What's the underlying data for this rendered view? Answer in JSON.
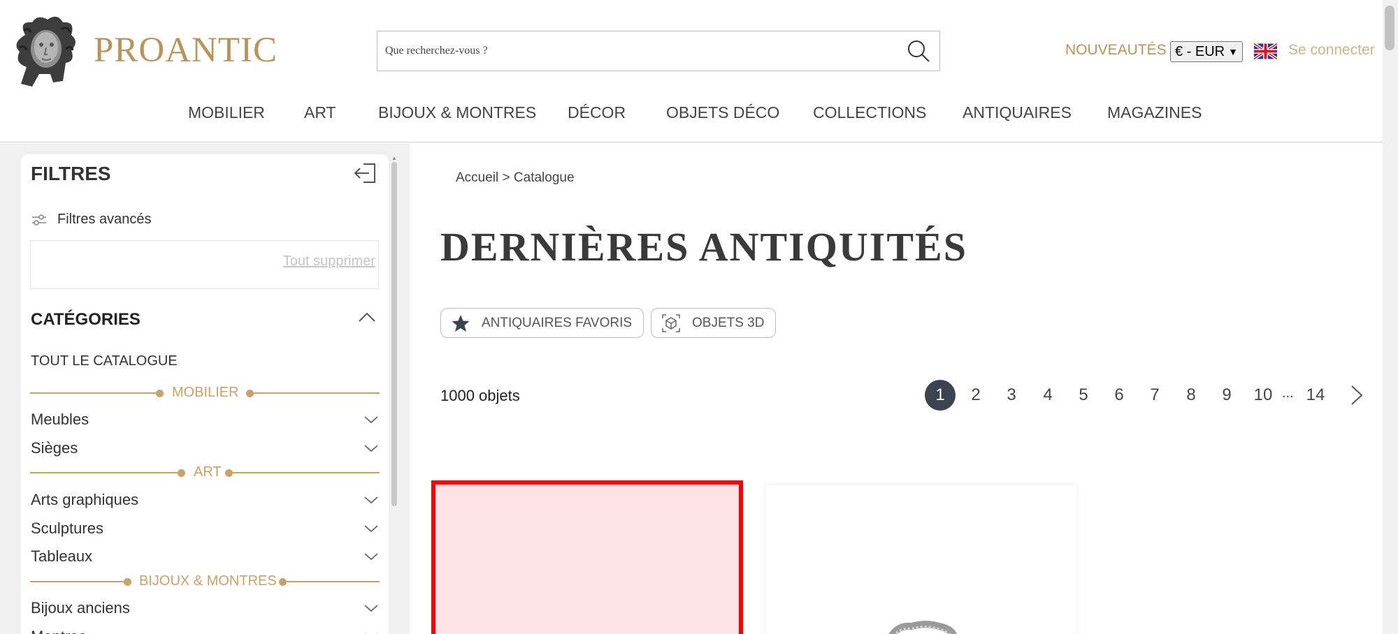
{
  "header": {
    "logo_text": "PROANTIC",
    "search_placeholder": "Que recherchez-vous ?",
    "new_label": "NOUVEAUTÉS",
    "currency": "€ - EUR",
    "login_label": "Se connecter"
  },
  "nav": {
    "items": [
      "MOBILIER",
      "ART",
      "BIJOUX & MONTRES",
      "DÉCOR",
      "OBJETS DÉCO",
      "COLLECTIONS",
      "ANTIQUAIRES",
      "MAGAZINES"
    ]
  },
  "sidebar": {
    "title": "FILTRES",
    "advanced_label": "Filtres avancés",
    "clear_label": "Tout supprimer",
    "categories_title": "CATÉGORIES",
    "all_catalog_label": "TOUT LE CATALOGUE",
    "sections": [
      "MOBILIER",
      "ART",
      "BIJOUX & MONTRES"
    ],
    "items": [
      "Meubles",
      "Sièges",
      "Arts graphiques",
      "Sculptures",
      "Tableaux",
      "Bijoux anciens",
      "Montres"
    ]
  },
  "main": {
    "breadcrumb": "Accueil > Catalogue",
    "title": "DERNIÈRES ANTIQUITÉS",
    "fav_label": "ANTIQUAIRES FAVORIS",
    "objects3d_label": "OBJETS 3D",
    "count_label": "1000 objets",
    "pages": [
      "1",
      "2",
      "3",
      "4",
      "5",
      "6",
      "7",
      "8",
      "9",
      "10"
    ],
    "ellipsis": "...",
    "last_page": "14",
    "current_page": 1
  },
  "colors": {
    "gold": "#b9935a",
    "accent_line": "#c9a26a",
    "active_page": "#3b4350",
    "highlight_border": "#ff0000",
    "highlight_fill": "#fde2e4"
  }
}
